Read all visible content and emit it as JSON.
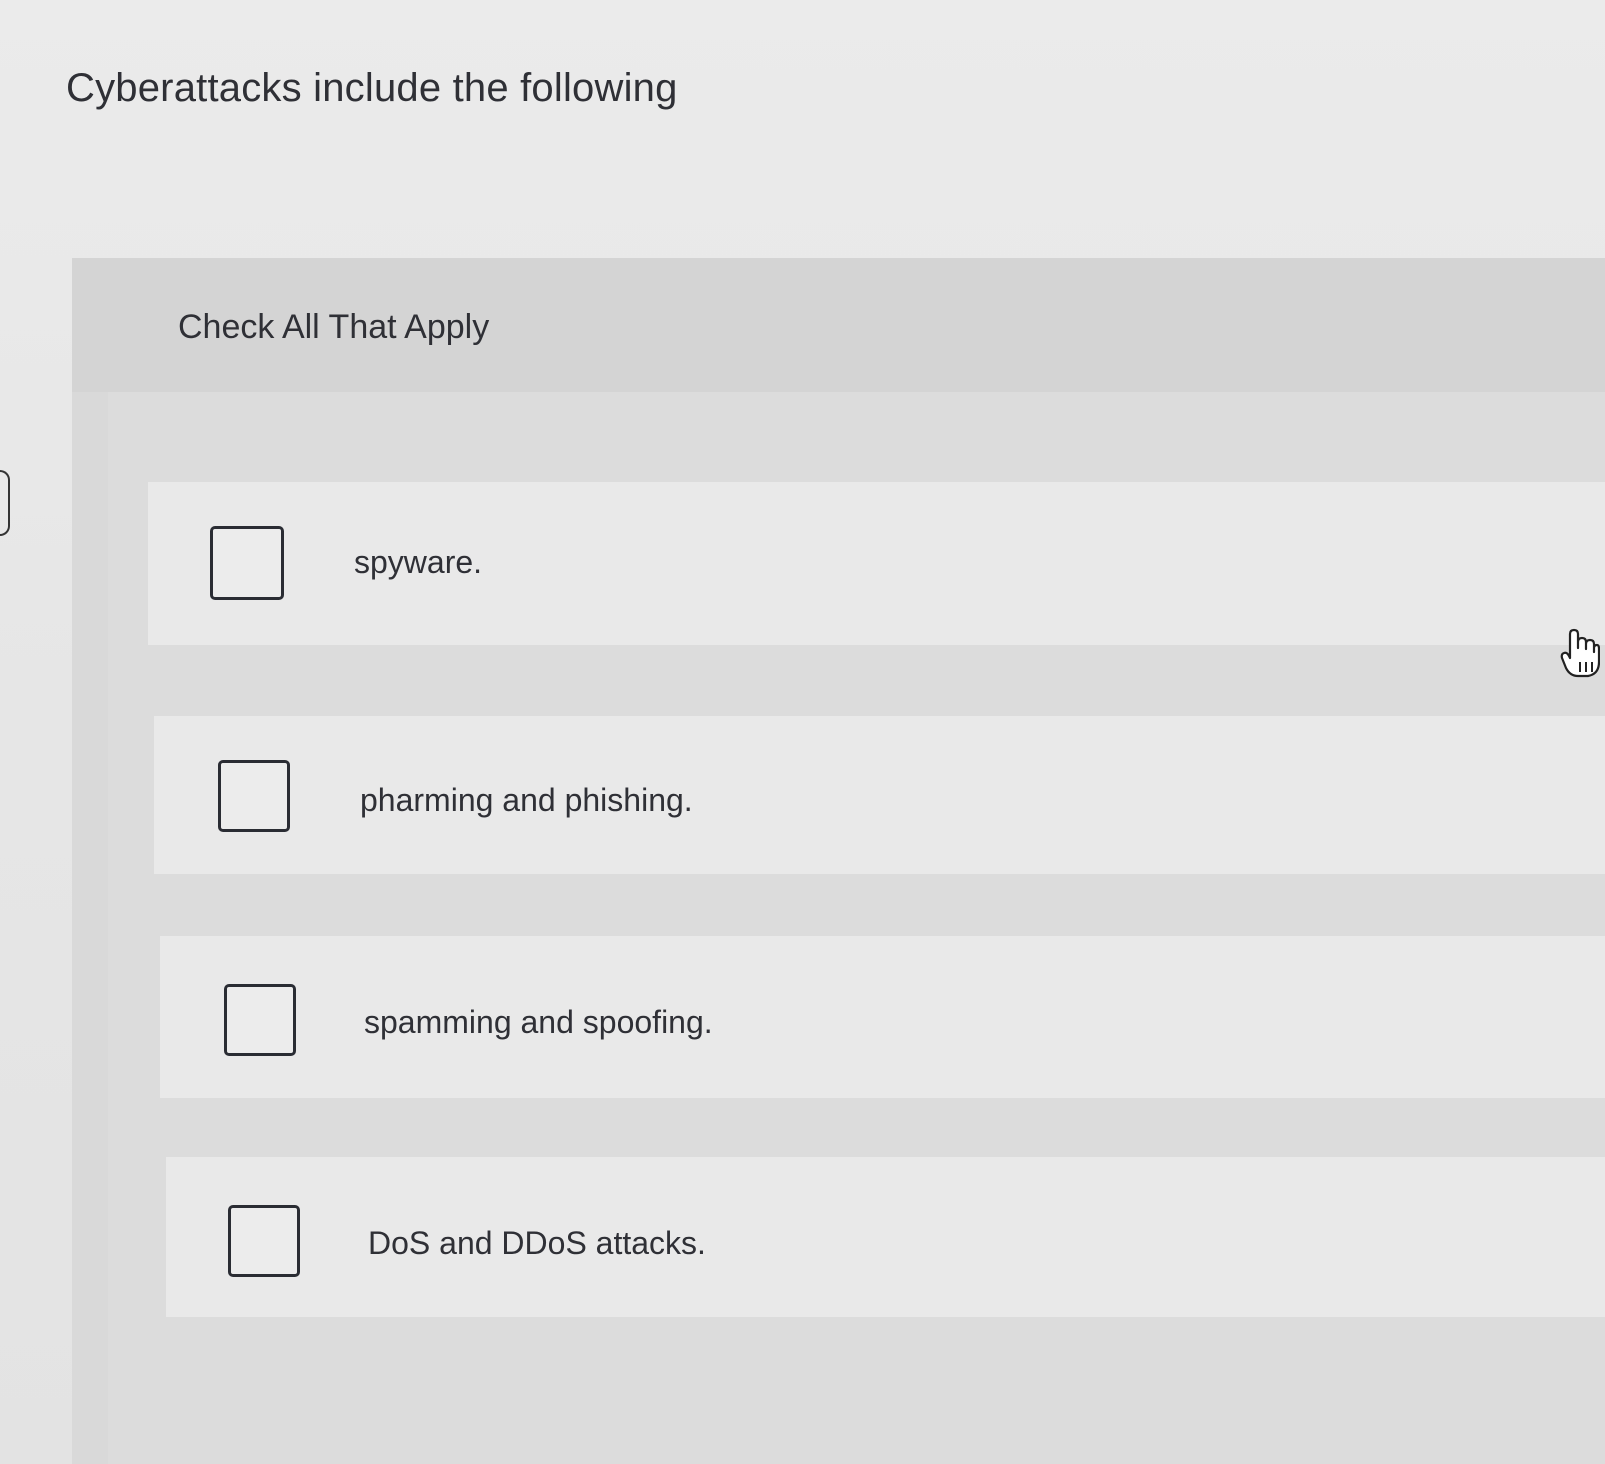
{
  "question": {
    "title": "Cyberattacks include the following"
  },
  "panel": {
    "instruction": "Check All That Apply"
  },
  "options": [
    {
      "label": "spyware.",
      "checked": false
    },
    {
      "label": "pharming and phishing.",
      "checked": false
    },
    {
      "label": "spamming and spoofing.",
      "checked": false
    },
    {
      "label": "DoS and DDoS attacks.",
      "checked": false
    }
  ],
  "cursor": {
    "icon": "hand-pointer-icon"
  },
  "colors": {
    "background": "#e8e8e8",
    "panel": "#d9d9d9",
    "option_background": "#e9e9e9",
    "text": "#2f3036",
    "checkbox_border": "#2a2c33"
  }
}
